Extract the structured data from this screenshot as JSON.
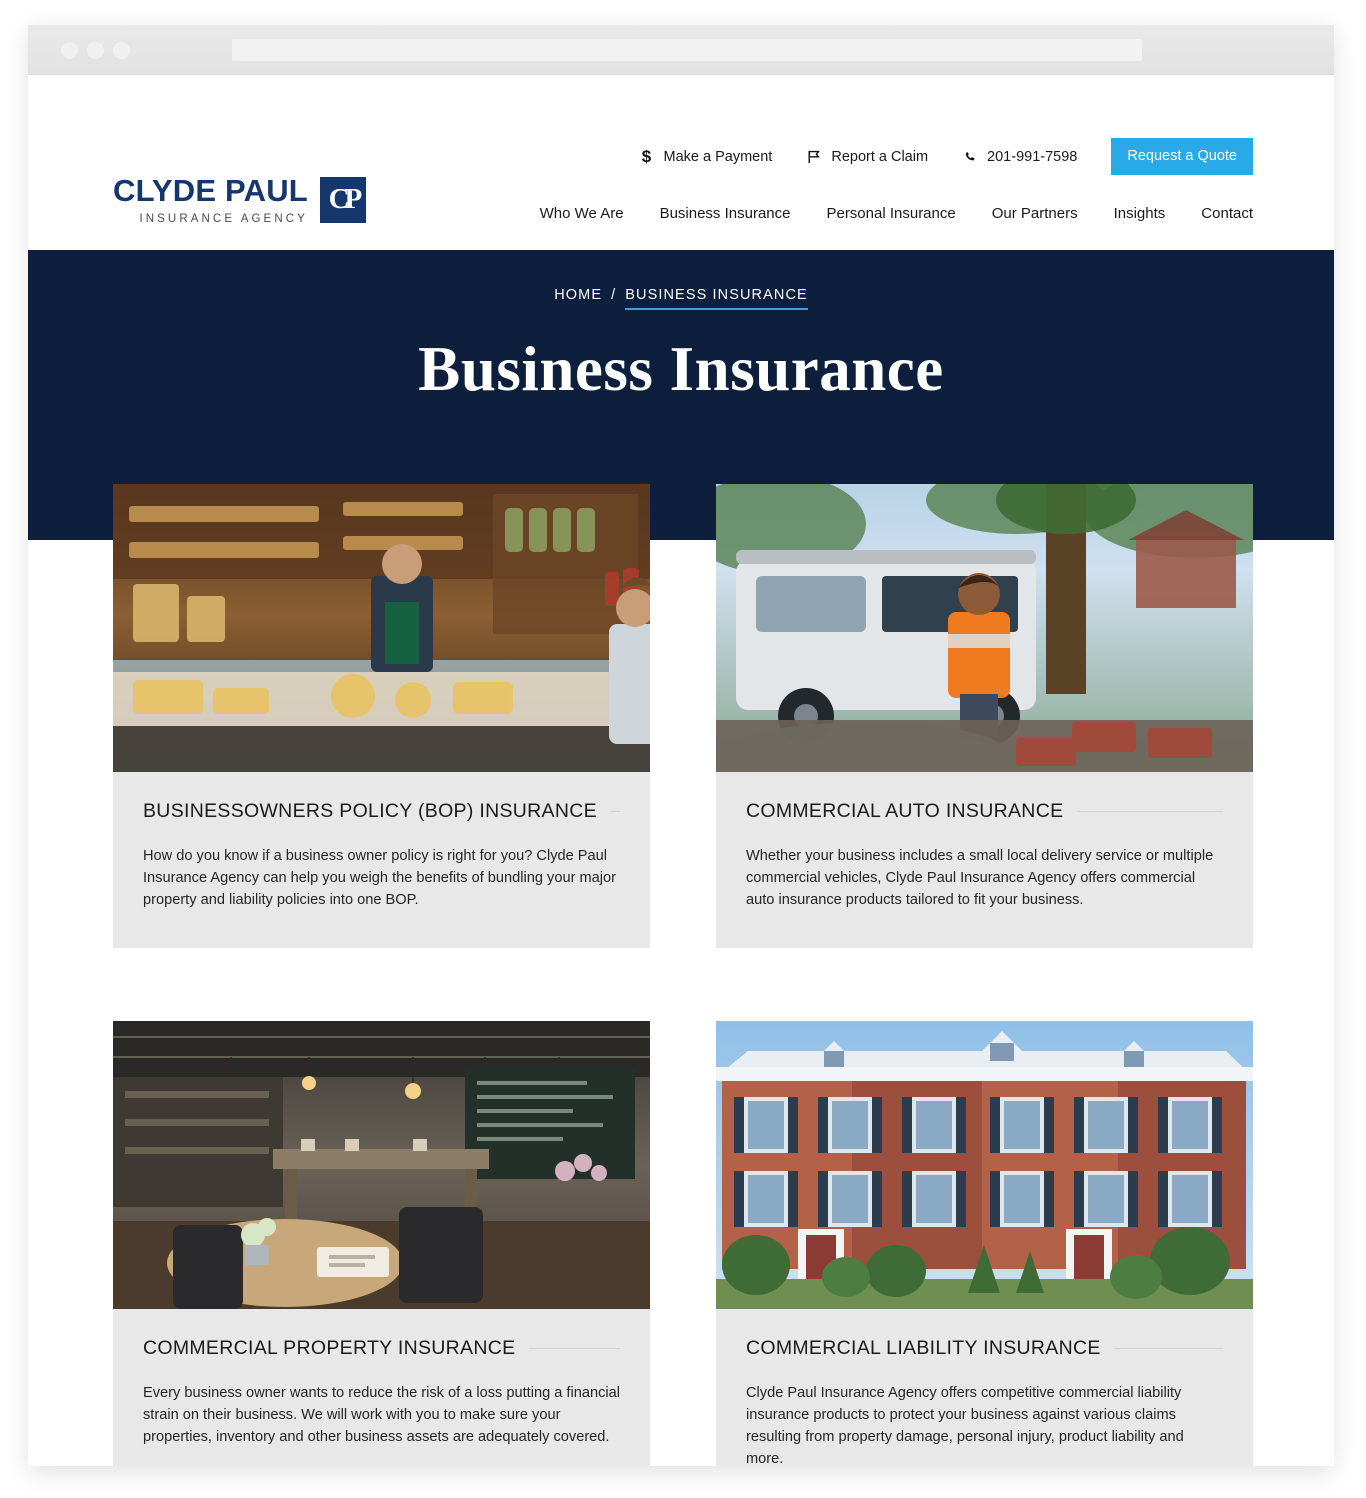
{
  "browser": {
    "address_value": "",
    "address_placeholder": ""
  },
  "colors": {
    "navy": "#0e1f3d",
    "logo_navy": "#16376b",
    "accent_blue": "#29a9e8",
    "card_bg": "#e8e8e8"
  },
  "utility_bar": {
    "items": [
      {
        "icon": "dollar-icon",
        "label": "Make a Payment"
      },
      {
        "icon": "flag-icon",
        "label": "Report a Claim"
      },
      {
        "icon": "phone-icon",
        "label": "201-991-7598"
      }
    ],
    "cta_label": "Request a Quote"
  },
  "logo": {
    "name": "CLYDE PAUL",
    "subtitle": "INSURANCE AGENCY",
    "monogram": "CP"
  },
  "nav": {
    "items": [
      {
        "label": "Who We Are",
        "active": false
      },
      {
        "label": "Business Insurance",
        "active": true
      },
      {
        "label": "Personal Insurance",
        "active": false
      },
      {
        "label": "Our Partners",
        "active": false
      },
      {
        "label": "Insights",
        "active": false
      },
      {
        "label": "Contact",
        "active": false
      }
    ]
  },
  "hero": {
    "breadcrumb_home": "HOME",
    "breadcrumb_separator": "/",
    "breadcrumb_current": "BUSINESS INSURANCE",
    "title": "Business Insurance"
  },
  "cards": [
    {
      "title": "BUSINESSOWNERS POLICY (BOP) INSURANCE",
      "description": "How do you know if a business owner policy is right for you? Clyde Paul Insurance Agency can help you weigh the benefits of bundling your major property and liability policies into one BOP.",
      "image_alt": "cheese-shop-counter-photo"
    },
    {
      "title": "COMMERCIAL AUTO INSURANCE",
      "description": "Whether your business includes a small local delivery service or multiple commercial vehicles, Clyde Paul Insurance Agency offers commercial auto insurance products tailored to fit your business.",
      "image_alt": "worker-beside-white-van-photo"
    },
    {
      "title": "COMMERCIAL PROPERTY INSURANCE",
      "description": "Every business owner wants to reduce the risk of a loss putting a financial strain on their business. We will work with you to make sure your properties, inventory and other business assets are adequately covered.",
      "image_alt": "restaurant-interior-photo"
    },
    {
      "title": "COMMERCIAL LIABILITY INSURANCE",
      "description": "Clyde Paul Insurance Agency offers competitive commercial liability insurance products to protect your business against various claims resulting from property damage, personal injury, product liability and more.",
      "image_alt": "brick-townhouses-photo"
    }
  ]
}
